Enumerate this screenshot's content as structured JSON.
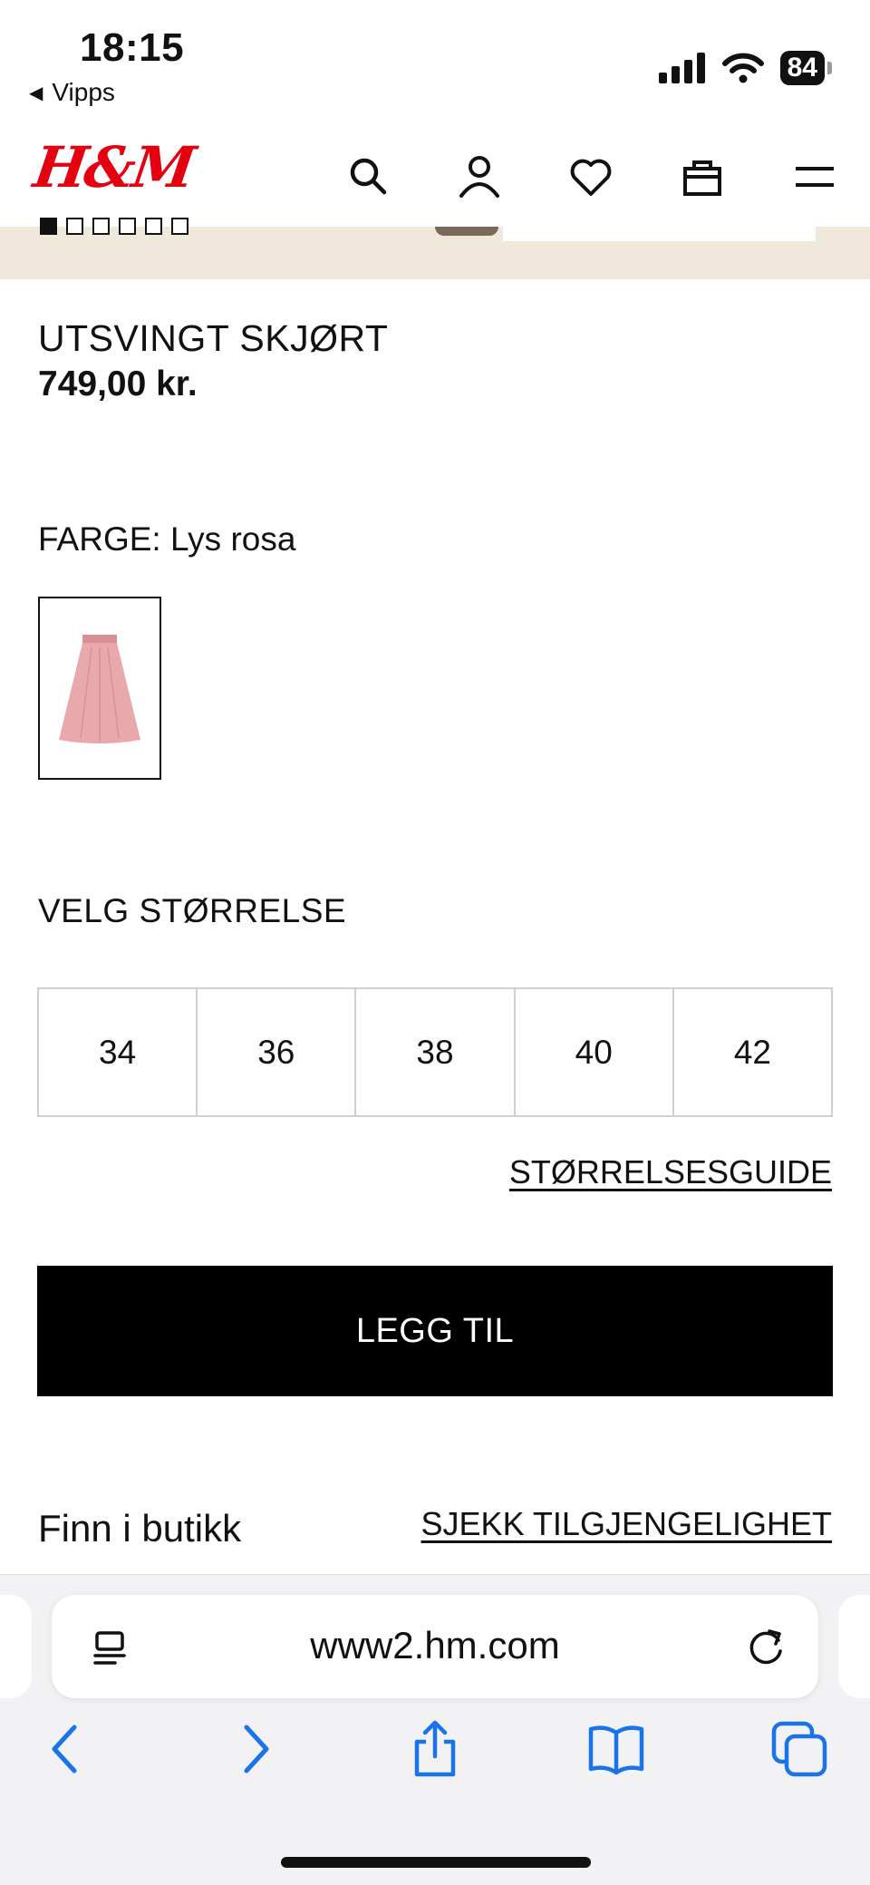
{
  "status_bar": {
    "time": "18:15",
    "back_app": "Vipps",
    "battery": "84"
  },
  "header": {
    "logo": "H&M",
    "icons": [
      "search-icon",
      "account-icon",
      "heart-icon",
      "bag-icon",
      "menu-icon"
    ]
  },
  "gallery": {
    "dot_count": 6,
    "active_index": 0
  },
  "product": {
    "name": "UTSVINGT SKJØRT",
    "price": "749,00 kr.",
    "color_line": "FARGE: Lys rosa",
    "swatch_color": "#e9a9ac"
  },
  "size": {
    "title": "VELG STØRRELSE",
    "options": [
      "34",
      "36",
      "38",
      "40",
      "42"
    ],
    "guide_label": "STØRRELSESGUIDE"
  },
  "cta": {
    "add_label": "LEGG TIL"
  },
  "store": {
    "find_label": "Finn i butikk",
    "check_label": "SJEKK TILGJENGELIGHET"
  },
  "browser": {
    "url": "www2.hm.com",
    "accent": "#1a73e8",
    "toolbar_icons": [
      "back-icon",
      "forward-icon",
      "share-icon",
      "bookmarks-icon",
      "tabs-icon"
    ]
  },
  "colors": {
    "brand_red": "#e50010",
    "button_black": "#000000"
  }
}
